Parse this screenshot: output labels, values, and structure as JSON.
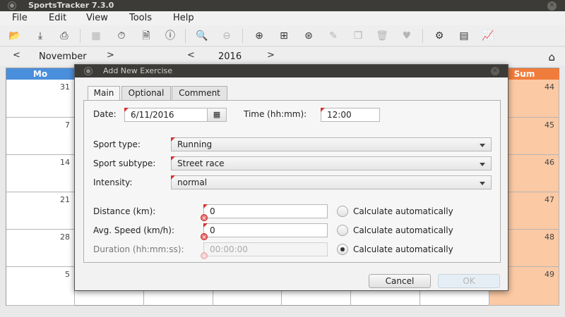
{
  "window": {
    "title": "SportsTracker 7.3.0"
  },
  "menu": [
    "File",
    "Edit",
    "View",
    "Tools",
    "Help"
  ],
  "toolbar_icons": [
    "folder-open-icon",
    "save-icon",
    "print-icon",
    "calendar-icon",
    "stopwatch-icon",
    "document-icon",
    "info-icon",
    "zoom-in-icon",
    "zoom-out-icon",
    "add-exercise-icon",
    "add-note-icon",
    "add-weight-icon",
    "edit-icon",
    "copy-icon",
    "delete-icon",
    "heart-rate-icon",
    "settings-icon",
    "statistics-icon",
    "chart-icon"
  ],
  "nav": {
    "prev_month": "<",
    "month": "November",
    "next_month": ">",
    "prev_year": "<",
    "year": "2016",
    "next_year": ">",
    "home_icon": "home-icon"
  },
  "calendar": {
    "first_day_header": "Mo",
    "last_day_header": "Sum",
    "week_dates": [
      "31",
      "7",
      "14",
      "21",
      "28",
      "5"
    ],
    "week_numbers": [
      "44",
      "45",
      "46",
      "47",
      "48",
      "49"
    ],
    "colors": {
      "monday_header": "#4a8fdc",
      "sum_header": "#f07c3c",
      "week_column": "#fbc9a4"
    }
  },
  "dialog": {
    "title": "Add New Exercise",
    "tabs": [
      "Main",
      "Optional",
      "Comment"
    ],
    "date_label": "Date:",
    "date_value": "6/11/2016",
    "time_label": "Time (hh:mm):",
    "time_value": "12:00",
    "sport_type_label": "Sport type:",
    "sport_type_value": "Running",
    "sport_subtype_label": "Sport subtype:",
    "sport_subtype_value": "Street race",
    "intensity_label": "Intensity:",
    "intensity_value": "normal",
    "distance_label": "Distance (km):",
    "distance_value": "0",
    "speed_label": "Avg. Speed (km/h):",
    "speed_value": "0",
    "duration_label": "Duration (hh:mm:ss):",
    "duration_placeholder": "00:00:00",
    "calc_auto": "Calculate automatically",
    "cancel": "Cancel",
    "ok": "OK"
  }
}
